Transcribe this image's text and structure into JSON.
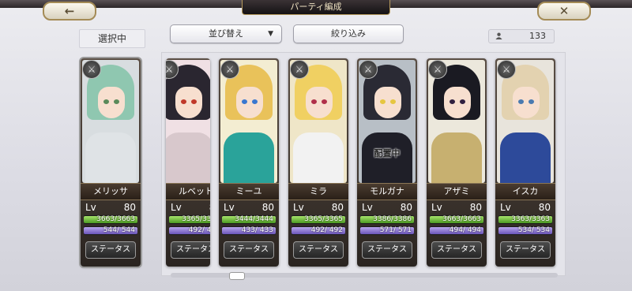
{
  "header": {
    "title": "パーティ編成",
    "back_label": "←",
    "close_label": "✕"
  },
  "toolbar": {
    "selected_label": "選択中",
    "sort_label": "並び替え",
    "sort_arrow": "▼",
    "filter_label": "絞り込み",
    "count": "133"
  },
  "status_label": "ステータス",
  "deploy_label": "配置中",
  "lv_label": "Lv",
  "cards": [
    {
      "name": "メリッサ",
      "lv": "80",
      "hp": "3663/3663",
      "sp": "544/ 544",
      "hair": "#8fc7b0",
      "body": "#dfe3e6",
      "eye": "#5a8a5a",
      "bg": "#d8dde0"
    },
    {
      "name": "ルベット",
      "lv": "80",
      "hp": "3365/3365",
      "sp": "492/ 492",
      "hair": "#2a2630",
      "body": "#d8c8cc",
      "eye": "#c0392b",
      "bg": "#f0e0e4"
    },
    {
      "name": "ミーユ",
      "lv": "80",
      "hp": "3444/3444",
      "sp": "433/ 433",
      "hair": "#e9c25a",
      "body": "#2aa39a",
      "eye": "#3a78d0",
      "bg": "#f3edd2"
    },
    {
      "name": "ミラ",
      "lv": "80",
      "hp": "3365/3365",
      "sp": "492/ 492",
      "hair": "#f0d062",
      "body": "#f2f2f2",
      "eye": "#b0304a",
      "bg": "#efe6c8"
    },
    {
      "name": "モルガナ",
      "lv": "80",
      "hp": "3386/3386",
      "sp": "571/ 571",
      "hair": "#2a2a34",
      "body": "#1f1f28",
      "eye": "#e6c640",
      "bg": "#b8bfc6"
    },
    {
      "name": "アザミ",
      "lv": "80",
      "hp": "3663/3663",
      "sp": "494/ 494",
      "hair": "#1a1a22",
      "body": "#c7b070",
      "eye": "#302040",
      "bg": "#ece8dc"
    },
    {
      "name": "イスカ",
      "lv": "80",
      "hp": "3363/3363",
      "sp": "534/ 534",
      "hair": "#e3d2b0",
      "body": "#2d4a9a",
      "eye": "#4a7ab0",
      "bg": "#e8e4dc"
    }
  ]
}
